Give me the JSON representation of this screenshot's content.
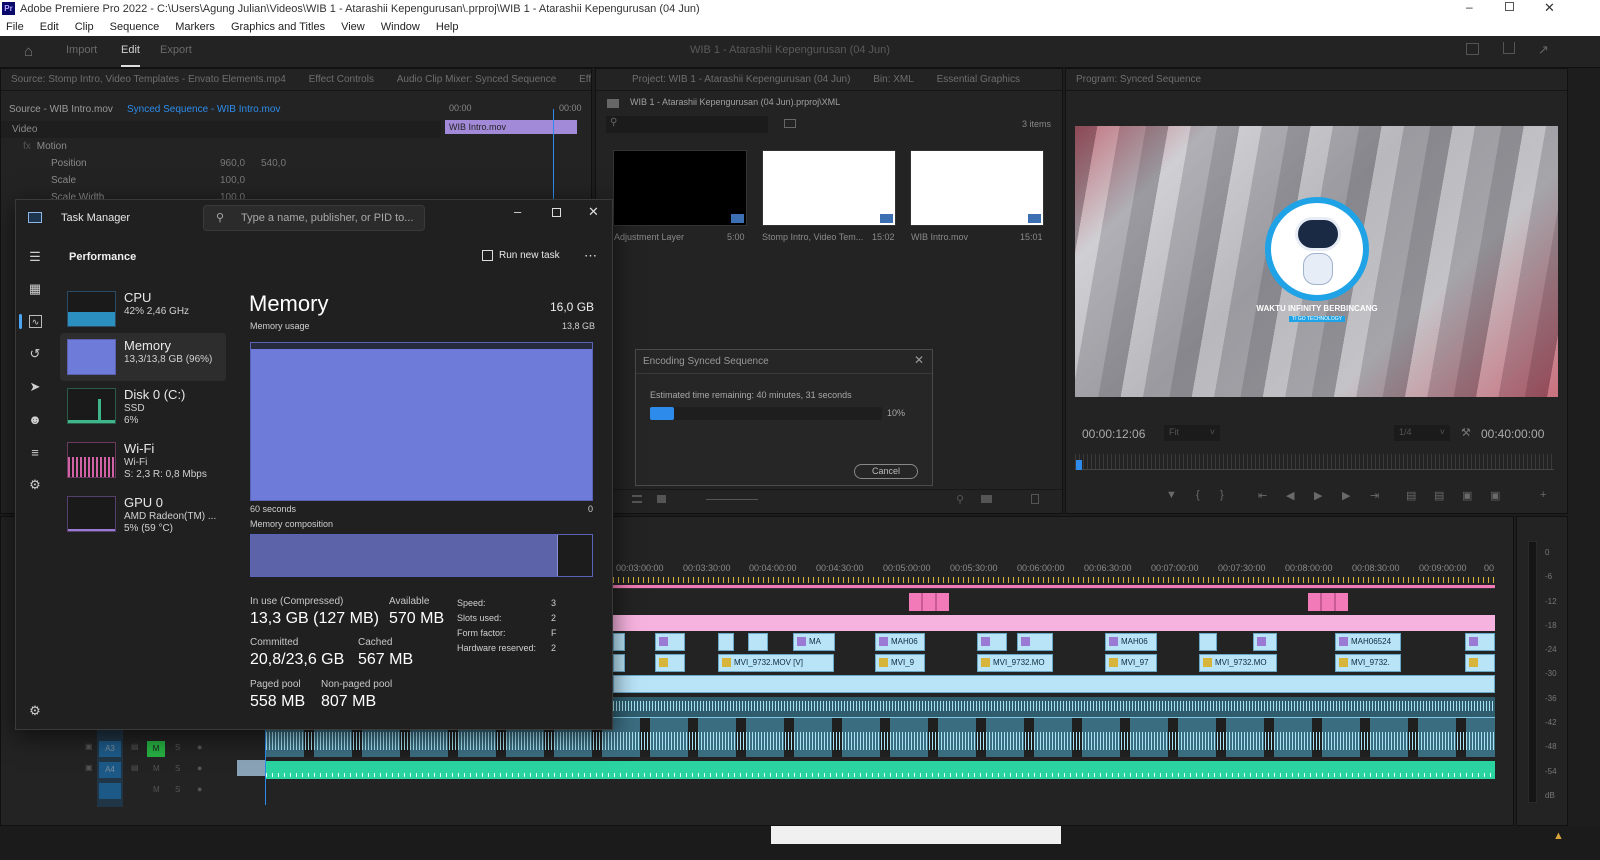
{
  "app": {
    "title": "Adobe Premiere Pro 2022 - C:\\Users\\Agung Julian\\Videos\\WIB 1 - Atarashii Kepengurusan\\.prproj\\WIB 1 - Atarashii Kepengurusan (04 Jun)",
    "menu": [
      "File",
      "Edit",
      "Clip",
      "Sequence",
      "Markers",
      "Graphics and Titles",
      "View",
      "Window",
      "Help"
    ],
    "workspace_tabs": [
      "Import",
      "Edit",
      "Export"
    ],
    "project_title": "WIB 1 - Atarashii Kepengurusan (04 Jun)"
  },
  "source_panel": {
    "tabs": [
      "Source: Stomp Intro, Video Templates - Envato Elements.mp4",
      "Effect Controls",
      "Audio Clip Mixer: Synced Sequence",
      "Effe"
    ],
    "source_label": "Source - WIB Intro.mov",
    "sequence_label": "Synced Sequence - WIB Intro.mov",
    "time_start": "00:00",
    "time_end": "00:00",
    "clip_name": "WIB Intro.mov",
    "video_header": "Video",
    "motion_label": "Motion",
    "properties": [
      {
        "name": "Position",
        "v1": "960,0",
        "v2": "540,0"
      },
      {
        "name": "Scale",
        "v1": "100,0",
        "v2": ""
      },
      {
        "name": "Scale Width",
        "v1": "100,0",
        "v2": ""
      }
    ]
  },
  "project_panel": {
    "tabs": [
      "Project: WIB 1 - Atarashii Kepengurusan (04 Jun)",
      "Bin: XML",
      "Essential Graphics"
    ],
    "path": "WIB 1 - Atarashii Kepengurusan (04 Jun).prproj\\XML",
    "items_count": "3 items",
    "items": [
      {
        "name": "Adjustment Layer",
        "dur": "5:00",
        "color": "#000000"
      },
      {
        "name": "Stomp Intro, Video Tem...",
        "dur": "15:02",
        "color": "#ffffff"
      },
      {
        "name": "WIB Intro.mov",
        "dur": "15:01",
        "color": "#ffffff"
      }
    ]
  },
  "program_panel": {
    "tab": "Program: Synced Sequence",
    "logo_text": "WAKTU INFINITY BERBINCANG",
    "logo_sub": "TI GO TECHNOLOGY",
    "timecode": "00:00:12:06",
    "fit": "Fit",
    "quality": "1/4",
    "duration": "00:40:00:00"
  },
  "timeline": {
    "ruler": [
      "00:03:00:00",
      "00:03:30:00",
      "00:04:00:00",
      "00:04:30:00",
      "00:05:00:00",
      "00:05:30:00",
      "00:06:00:00",
      "00:06:30:00",
      "00:07:00:00",
      "00:07:30:00",
      "00:08:00:00",
      "00:08:30:00",
      "00:09:00:00",
      "00"
    ],
    "tracks": [
      "A3",
      "A4"
    ],
    "track_flags": [
      "M",
      "S"
    ],
    "v2_clips": [
      "MA",
      "MAH06",
      "MAH06",
      "MAH06524"
    ],
    "v1_clips": [
      "MVI_9732.MOV [V]",
      "MVI_9",
      "MVI_9732.MO",
      "MVI_97",
      "MVI_9732.MO",
      "MVI_9732."
    ],
    "meter_labels": [
      "0",
      "-6",
      "-12",
      "-18",
      "-24",
      "-30",
      "-36",
      "-42",
      "-48",
      "-54",
      "dB"
    ]
  },
  "encoding_dialog": {
    "title": "Encoding Synced Sequence",
    "remaining": "Estimated time remaining: 40 minutes, 31 seconds",
    "percent_label": "10%",
    "progress": 0.1,
    "cancel": "Cancel"
  },
  "task_manager": {
    "title": "Task Manager",
    "search_placeholder": "Type a name, publisher, or PID to...",
    "section": "Performance",
    "run_new_task": "Run new task",
    "perf_items": [
      {
        "name": "CPU",
        "sub1": "42% 2,46 GHz",
        "sub2": "",
        "sub3": ""
      },
      {
        "name": "Memory",
        "sub1": "13,3/13,8 GB (96%)",
        "sub2": "",
        "sub3": ""
      },
      {
        "name": "Disk 0 (C:)",
        "sub1": "SSD",
        "sub2": "6%",
        "sub3": ""
      },
      {
        "name": "Wi-Fi",
        "sub1": "Wi-Fi",
        "sub2": "S: 2,3 R: 0,8 Mbps",
        "sub3": ""
      },
      {
        "name": "GPU 0",
        "sub1": "AMD Radeon(TM) ...",
        "sub2": "5% (59 °C)",
        "sub3": ""
      }
    ],
    "memory": {
      "heading": "Memory",
      "total": "16,0 GB",
      "usage_label": "Memory usage",
      "usage_max": "13,8 GB",
      "axis_left": "60 seconds",
      "axis_right": "0",
      "composition_label": "Memory composition",
      "in_use_label": "In use (Compressed)",
      "in_use": "13,3 GB (127 MB)",
      "available_label": "Available",
      "available": "570 MB",
      "committed_label": "Committed",
      "committed": "20,8/23,6 GB",
      "cached_label": "Cached",
      "cached": "567 MB",
      "paged_label": "Paged pool",
      "paged": "558 MB",
      "nonpaged_label": "Non-paged pool",
      "nonpaged": "807 MB",
      "speed_label": "Speed:",
      "speed": "3",
      "slots_label": "Slots used:",
      "slots": "2",
      "form_label": "Form factor:",
      "form": "F",
      "hwres_label": "Hardware reserved:",
      "hwres": "2",
      "usage_fraction": 0.96
    }
  },
  "colors": {
    "accent": "#2d8ceb",
    "clip_blue": "#b9e3f7",
    "clip_pink": "#f7a8d8",
    "audio_green": "#2ad3a0",
    "memory_fill": "#6f7bd9"
  }
}
